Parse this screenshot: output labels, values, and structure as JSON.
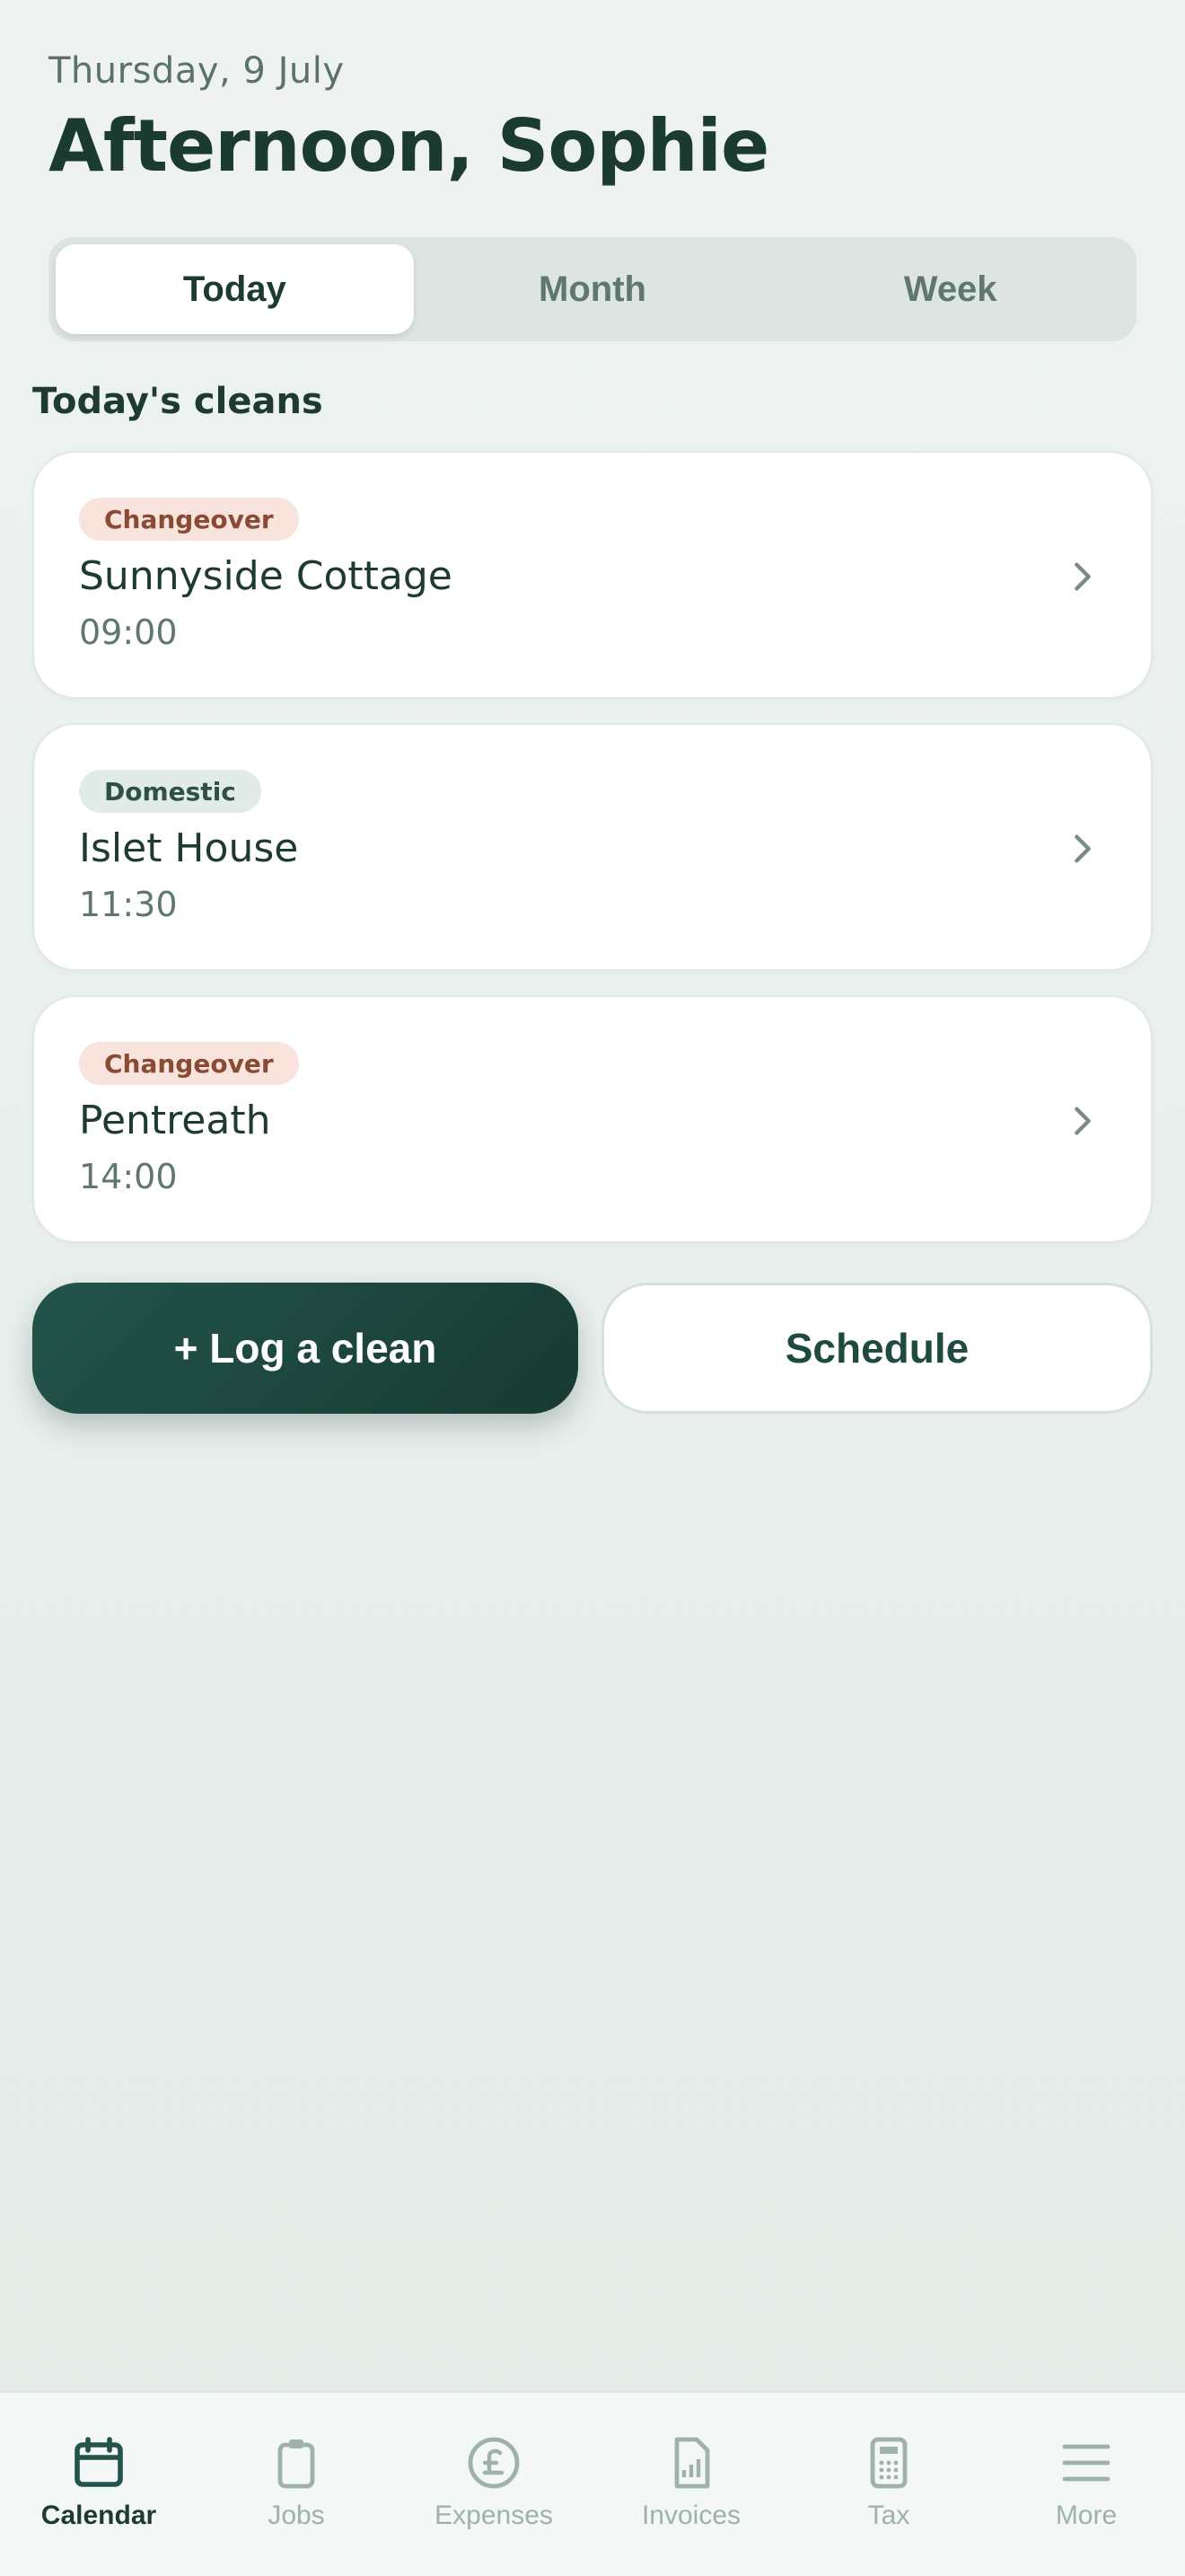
{
  "header": {
    "date": "Thursday, 9 July",
    "greeting": "Afternoon, Sophie"
  },
  "segments": [
    {
      "label": "Today",
      "active": true
    },
    {
      "label": "Month",
      "active": false
    },
    {
      "label": "Week",
      "active": false
    }
  ],
  "section_title": "Today's cleans",
  "cleans": [
    {
      "type": "Changeover",
      "name": "Sunnyside Cottage",
      "time": "09:00"
    },
    {
      "type": "Domestic",
      "name": "Islet House",
      "time": "11:30"
    },
    {
      "type": "Changeover",
      "name": "Pentreath",
      "time": "14:00"
    }
  ],
  "actions": {
    "log_clean": "+ Log a clean",
    "schedule": "Schedule"
  },
  "tabbar": [
    {
      "label": "Calendar",
      "icon": "calendar-icon",
      "active": true
    },
    {
      "label": "Jobs",
      "icon": "clipboard-icon",
      "active": false
    },
    {
      "label": "Expenses",
      "icon": "pound-icon",
      "active": false
    },
    {
      "label": "Invoices",
      "icon": "invoice-icon",
      "active": false
    },
    {
      "label": "Tax",
      "icon": "calculator-icon",
      "active": false
    },
    {
      "label": "More",
      "icon": "menu-icon",
      "active": false
    }
  ],
  "colors": {
    "primary": "#1b3a32",
    "accent_button": "#23544b",
    "changeover_badge_bg": "#f8e4dc",
    "changeover_badge_text": "#8a4a35",
    "domestic_badge_bg": "#e1ebe8",
    "domestic_badge_text": "#2e5048",
    "inactive_tab": "#9eb1ac"
  }
}
